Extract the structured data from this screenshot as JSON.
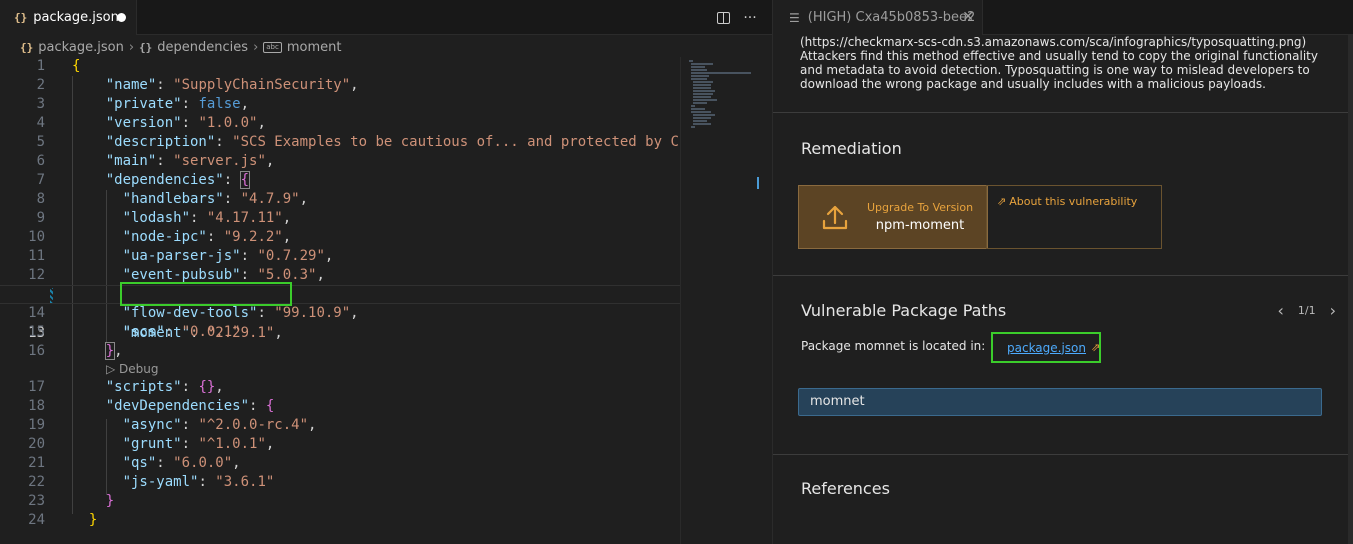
{
  "editor": {
    "tab": {
      "icon": "{}",
      "label": "package.json"
    },
    "breadcrumb": {
      "file": "package.json",
      "object": "dependencies",
      "key": "moment",
      "abc_badge": "abc",
      "object_icon": "{}"
    },
    "codelens_label": "Debug",
    "lines": [
      {
        "n": "1"
      },
      {
        "n": "2"
      },
      {
        "n": "3"
      },
      {
        "n": "4"
      },
      {
        "n": "5"
      },
      {
        "n": "6"
      },
      {
        "n": "7"
      },
      {
        "n": "8"
      },
      {
        "n": "9"
      },
      {
        "n": "10"
      },
      {
        "n": "11"
      },
      {
        "n": "12"
      },
      {
        "n": "13"
      },
      {
        "n": "14"
      },
      {
        "n": "15"
      },
      {
        "n": "16"
      },
      {
        "n": "17"
      },
      {
        "n": "18"
      },
      {
        "n": "19"
      },
      {
        "n": "20"
      },
      {
        "n": "21"
      },
      {
        "n": "22"
      },
      {
        "n": "23"
      },
      {
        "n": "24"
      }
    ],
    "code": {
      "name_k": "\"name\"",
      "name_v": "\"SupplyChainSecurity\"",
      "private_k": "\"private\"",
      "private_v": "false",
      "version_k": "\"version\"",
      "version_v": "\"1.0.0\"",
      "description_k": "\"description\"",
      "description_v": "\"SCS Examples to be cautious of... and protected by C",
      "main_k": "\"main\"",
      "main_v": "\"server.js\"",
      "dependencies_k": "\"dependencies\"",
      "handlebars_k": "\"handlebars\"",
      "handlebars_v": "\"4.7.9\"",
      "lodash_k": "\"lodash\"",
      "lodash_v": "\"4.17.11\"",
      "nodeipc_k": "\"node-ipc\"",
      "nodeipc_v": "\"9.2.2\"",
      "uaparser_k": "\"ua-parser-js\"",
      "uaparser_v": "\"0.7.29\"",
      "eventpubsub_k": "\"event-pubsub\"",
      "eventpubsub_v": "\"5.0.3\"",
      "moment_k": "\"moment\"",
      "moment_v": "\"2.29.1\"",
      "flowdev_k": "\"flow-dev-tools\"",
      "flowdev_v": "\"99.10.9\"",
      "scs_k": "\"scs\"",
      "scs_v": "\"0.0.1\"",
      "scripts_k": "\"scripts\"",
      "devdeps_k": "\"devDependencies\"",
      "async_k": "\"async\"",
      "async_v": "\"^2.0.0-rc.4\"",
      "grunt_k": "\"grunt\"",
      "grunt_v": "\"^1.0.1\"",
      "qs_k": "\"qs\"",
      "qs_v": "\"6.0.0\"",
      "jsyaml_k": "\"js-yaml\"",
      "jsyaml_v": "\"3.6.1\""
    }
  },
  "panel": {
    "tab_label": "(HIGH) Cxa45b0853-bee2",
    "description": [
      "(https://checkmarx-scs-cdn.s3.amazonaws.com/sca/infographics/typosquatting.png)",
      "Attackers find this method effective and usually tend to copy the original functionality",
      "and metadata to avoid detection. Typosquatting is one way to mislead developers to",
      "download the wrong package and usually includes with a malicious payloads."
    ],
    "remediation_title": "Remediation",
    "upgrade_label": "Upgrade To Version",
    "upgrade_package": "npm-moment",
    "about_label": "About this vulnerability",
    "paths_title": "Vulnerable Package Paths",
    "pager": "1/1",
    "located_label": "Package momnet is located in:",
    "located_link": "package.json",
    "package_field": "momnet",
    "references_title": "References"
  },
  "colors": {
    "key": "#9cdcfe",
    "string": "#ce9178",
    "boolean": "#569cd6",
    "bracket_level1": "#ffd700",
    "bracket_level2": "#da70d6",
    "highlight_box": "#3bcc2b",
    "accent_orange": "#e8a33d",
    "link": "#4daafc"
  }
}
